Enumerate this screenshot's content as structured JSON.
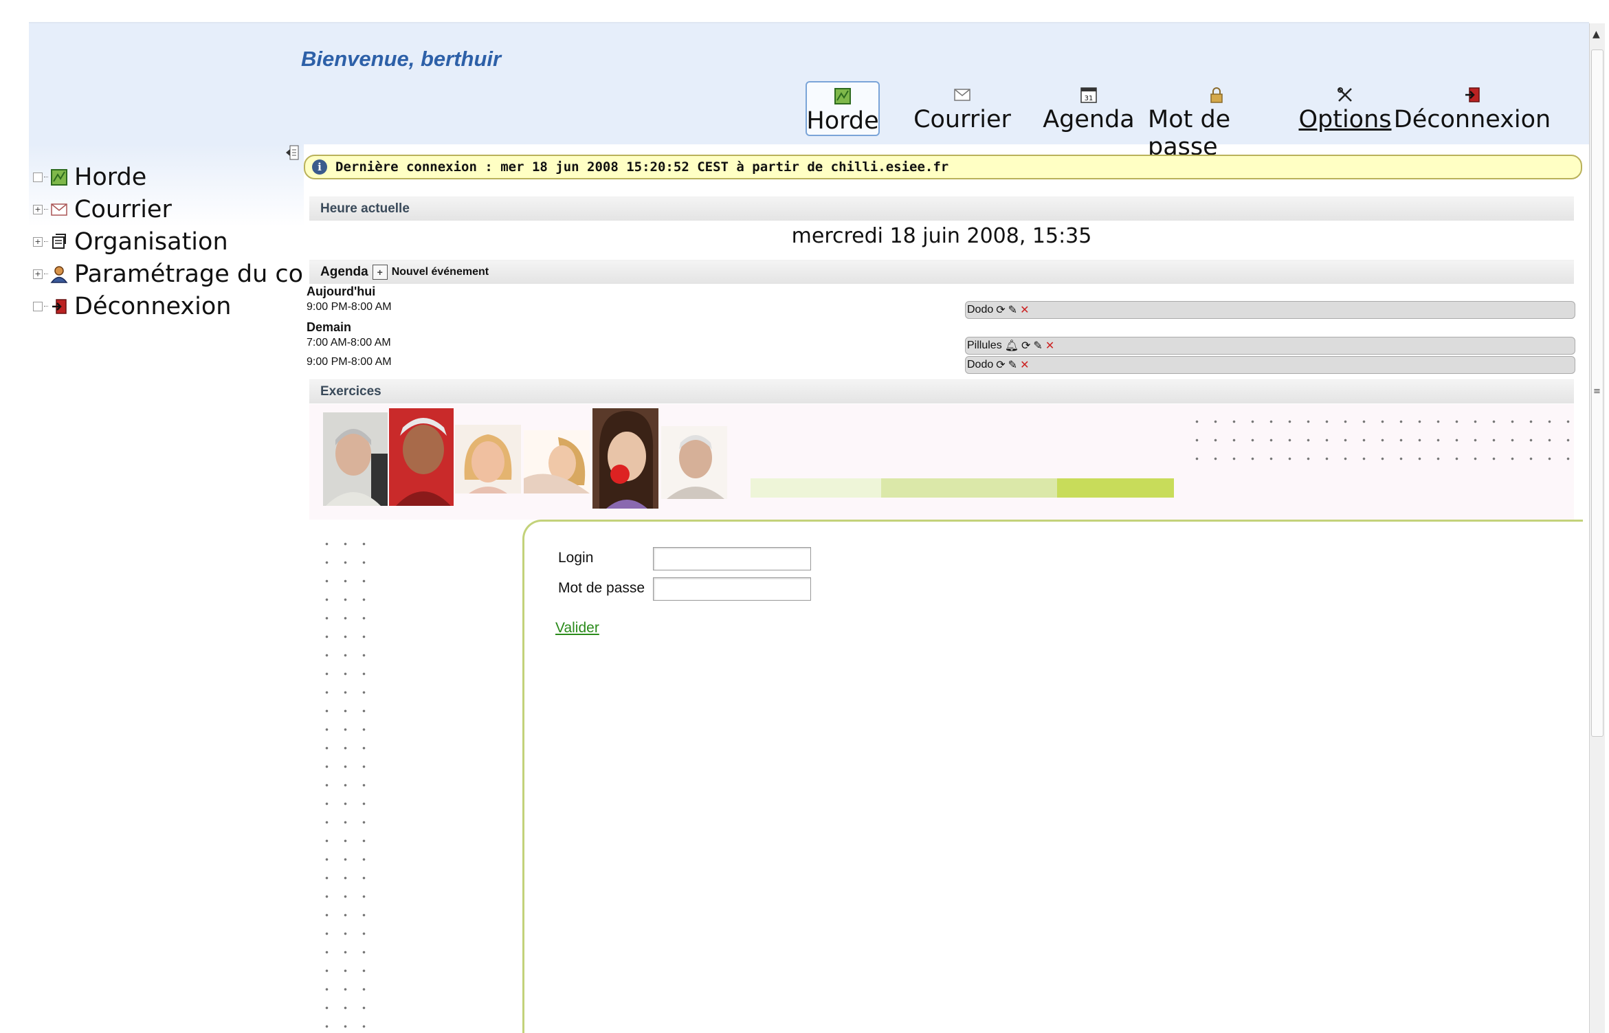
{
  "header": {
    "welcome": "Bienvenue, berthuir",
    "nav": [
      {
        "label": "Horde",
        "icon": "horde-icon",
        "active": true
      },
      {
        "label": "Courrier",
        "icon": "mail-icon"
      },
      {
        "label": "Agenda",
        "icon": "calendar-icon",
        "icon_text": "31"
      },
      {
        "label": "Mot de passe",
        "icon": "lock-icon"
      },
      {
        "label": "Options",
        "icon": "tools-icon"
      },
      {
        "label": "Déconnexion",
        "icon": "logout-icon"
      }
    ]
  },
  "sidebar": {
    "items": [
      {
        "label": "Horde",
        "toggle": "",
        "icon": "horde-icon"
      },
      {
        "label": "Courrier",
        "toggle": "+",
        "icon": "mail-icon"
      },
      {
        "label": "Organisation",
        "toggle": "+",
        "icon": "organisation-icon"
      },
      {
        "label": "Paramétrage du compte",
        "toggle": "+",
        "icon": "user-settings-icon"
      },
      {
        "label": "Déconnexion",
        "toggle": "",
        "icon": "logout-icon"
      }
    ]
  },
  "banner": {
    "text": "Dernière connexion : mer 18 jun 2008 15:20:52 CEST à partir de chilli.esiee.fr"
  },
  "clock": {
    "section_title": "Heure actuelle",
    "value": "mercredi 18 juin 2008, 15:35"
  },
  "agenda": {
    "section_title": "Agenda",
    "new_event_label": "Nouvel événement",
    "days": [
      {
        "label": "Aujourd'hui",
        "events": [
          {
            "time": "9:00 PM-8:00 AM",
            "title": "Dodo",
            "alarm": false
          }
        ]
      },
      {
        "label": "Demain",
        "events": [
          {
            "time": "7:00 AM-8:00 AM",
            "title": "Pillules",
            "alarm": true
          },
          {
            "time": "9:00 PM-8:00 AM",
            "title": "Dodo",
            "alarm": false
          }
        ]
      }
    ]
  },
  "exercices": {
    "section_title": "Exercices",
    "login_label": "Login",
    "login_value": "",
    "password_label": "Mot de passe",
    "password_value": "",
    "submit_label": "Valider"
  },
  "colors": {
    "header_bg": "#e6eefa",
    "welcome": "#2d60a8",
    "banner_bg": "#ffffc4",
    "link_green": "#2a8a1a",
    "accent_lime": "#c8dc5a"
  }
}
